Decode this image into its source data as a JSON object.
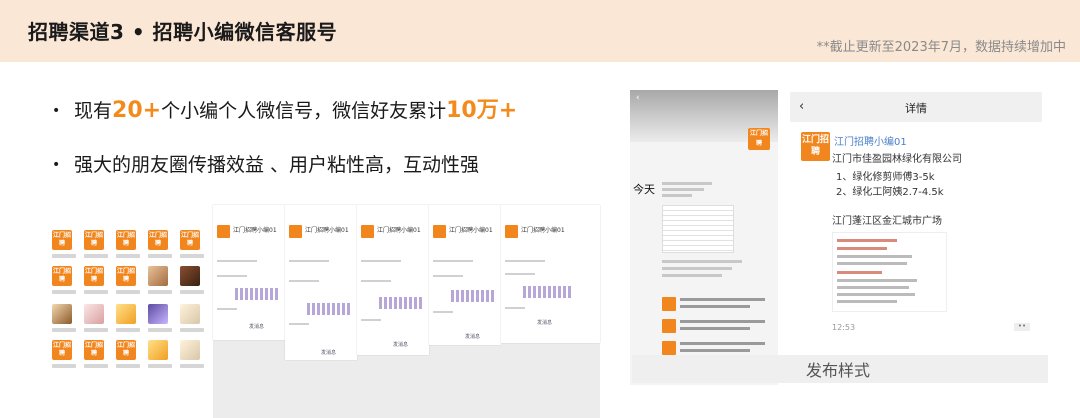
{
  "header": {
    "title": "招聘渠道3 • 招聘小编微信客服号",
    "note": "**截止更新至2023年7月，数据持续增加中"
  },
  "bullets": [
    {
      "pre": "现有",
      "hl1": "20+",
      "mid": "个小编个人微信号，微信好友累计",
      "hl2": "10万+"
    },
    {
      "text": "强大的朋友圈传播效益 、用户粘性高，互动性强"
    }
  ],
  "bullet_symbol": "•",
  "avatar_logo_text": "江门招聘",
  "profile_card": {
    "name": "江门招聘小编01",
    "button": "发消息"
  },
  "chat": {
    "back": "‹",
    "logo_text": "江门招聘",
    "today_label": "今天"
  },
  "detail": {
    "back": "‹",
    "title": "详情",
    "logo_text": "江门招聘",
    "name": "江门招聘小编01",
    "company": "江门市佳盈园林绿化有限公司",
    "job1": "1、绿化修剪师傅3-5k",
    "job2": "2、绿化工阿姨2.7-4.5k",
    "location": "江门蓬江区金汇城市广场",
    "time": "12:53",
    "more": "••"
  },
  "caption": "发布样式",
  "colors": {
    "accent": "#f28a1c",
    "header_bg": "#fbe7d6",
    "logo_orange": "#f2861e",
    "link_blue": "#4a7fc8"
  }
}
